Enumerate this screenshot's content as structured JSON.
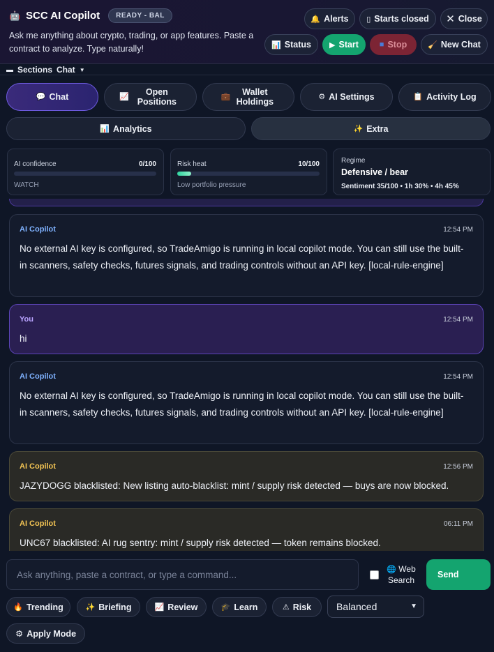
{
  "header": {
    "icon": "robot-icon",
    "title": "SCC AI Copilot",
    "badge": "READY - BAL",
    "subtitle": "Ask me anything about crypto, trading, or app features. Paste a contract to analyze. Type naturally!",
    "buttons": {
      "alerts": "Alerts",
      "starts_closed": "Starts closed",
      "close": "Close",
      "status": "Status",
      "start": "Start",
      "stop": "Stop",
      "new_chat": "New Chat"
    }
  },
  "sections": {
    "label": "Sections",
    "value": "Chat"
  },
  "tabs": [
    {
      "label": "Chat",
      "icon": "chat-icon"
    },
    {
      "label": "Open Positions",
      "icon": "chart-icon"
    },
    {
      "label": "Wallet Holdings",
      "icon": "briefcase-icon"
    },
    {
      "label": "AI Settings",
      "icon": "gear-icon"
    },
    {
      "label": "Activity Log",
      "icon": "clipboard-icon"
    },
    {
      "label": "Analytics",
      "icon": "bar-chart-icon"
    },
    {
      "label": "Extra",
      "icon": "sparkle-icon"
    }
  ],
  "stats": {
    "confidence": {
      "label": "AI confidence",
      "value": "0/100",
      "note": "WATCH",
      "fill": 0
    },
    "risk": {
      "label": "Risk heat",
      "value": "10/100",
      "note": "Low portfolio pressure",
      "fill": 0.1
    },
    "regime": {
      "label": "Regime",
      "value": "Defensive / bear",
      "note": "Sentiment 35/100 • 1h 30% • 4h 45%"
    }
  },
  "messages": [
    {
      "sender": "AI Copilot",
      "time": "12:54 PM",
      "text": "No external AI key is configured, so TradeAmigo is running in local copilot mode. You can still use the built-in scanners, safety checks, futures signals, and trading controls without an API key. [local-rule-engine]"
    },
    {
      "sender": "You",
      "time": "12:54 PM",
      "text": "hi"
    },
    {
      "sender": "AI Copilot",
      "time": "12:54 PM",
      "text": "No external AI key is configured, so TradeAmigo is running in local copilot mode. You can still use the built-in scanners, safety checks, futures signals, and trading controls without an API key. [local-rule-engine]"
    },
    {
      "sender": "AI Copilot",
      "time": "12:56 PM",
      "text": "JAZYDOGG blacklisted: New listing auto-blacklist: mint / supply risk detected — buys are now blocked."
    },
    {
      "sender": "AI Copilot",
      "time": "06:11 PM",
      "text": "UNC67 blacklisted: AI rug sentry: mint / supply risk detected — token remains blocked."
    }
  ],
  "composer": {
    "placeholder": "Ask anything, paste a contract, or type a command...",
    "web_search": "Web Search",
    "send": "Send",
    "chips": [
      "Trending",
      "Briefing",
      "Review",
      "Learn",
      "Risk"
    ],
    "mode": "Balanced",
    "apply": "Apply Mode"
  },
  "colors": {
    "accent_green": "#14a46f",
    "accent_purple": "#6e5be0",
    "stop_red": "#7c2434",
    "ai_sender": "#7fb2ff",
    "user_sender": "#b9a3ff",
    "alert_sender": "#f3c453"
  }
}
